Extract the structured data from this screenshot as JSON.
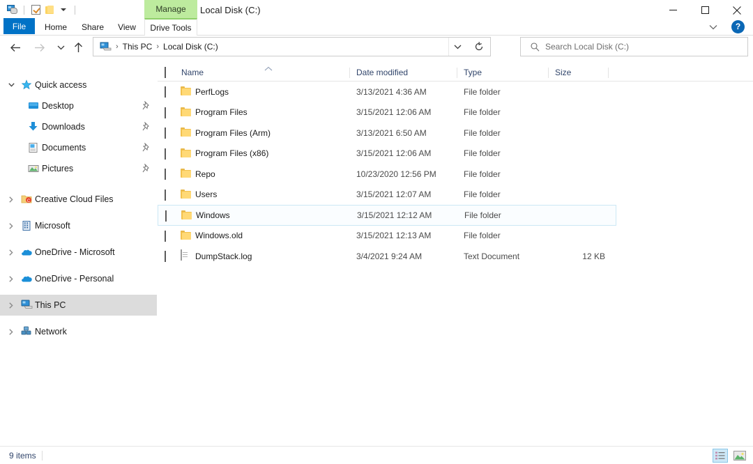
{
  "window": {
    "document_title": "Local Disk (C:)",
    "contextual_tab_group": "Manage",
    "controls": {
      "minimize": "Minimize",
      "maximize": "Maximize",
      "close": "Close"
    },
    "ribbon_collapse": "Minimize the Ribbon",
    "help": "?"
  },
  "quick_access_toolbar": {
    "items": [
      {
        "name": "explorer-icon",
        "label": "File Explorer"
      },
      {
        "name": "properties-icon",
        "label": "Properties"
      },
      {
        "name": "new-folder-icon",
        "label": "New folder"
      },
      {
        "name": "customize-caret-icon",
        "label": "Customize Quick Access Toolbar"
      }
    ]
  },
  "ribbon": {
    "tabs": [
      {
        "label": "File",
        "state": "file"
      },
      {
        "label": "Home",
        "state": "normal"
      },
      {
        "label": "Share",
        "state": "normal"
      },
      {
        "label": "View",
        "state": "normal"
      },
      {
        "label": "Drive Tools",
        "state": "active-contextual"
      }
    ]
  },
  "navigation": {
    "back": "Back",
    "forward": "Forward",
    "recent": "Recent locations",
    "up": "Up",
    "breadcrumb": {
      "root_icon": "this-pc-icon",
      "parts": [
        "This PC",
        "Local Disk (C:)"
      ],
      "separator": "›"
    },
    "address_dropdown": "Previous locations",
    "refresh": "Refresh “Local Disk (C:)”",
    "search": {
      "placeholder": "Search Local Disk (C:)",
      "value": "",
      "icon": "search-icon"
    }
  },
  "sidebar": {
    "items": [
      {
        "label": "Quick access",
        "icon": "star-icon",
        "level": 0,
        "expander": "chevron-down",
        "selected": false,
        "pinned": false
      },
      {
        "label": "Desktop",
        "icon": "desktop-icon",
        "level": 1,
        "expander": "none",
        "selected": false,
        "pinned": true
      },
      {
        "label": "Downloads",
        "icon": "downloads-icon",
        "level": 1,
        "expander": "none",
        "selected": false,
        "pinned": true
      },
      {
        "label": "Documents",
        "icon": "documents-icon",
        "level": 1,
        "expander": "none",
        "selected": false,
        "pinned": true
      },
      {
        "label": "Pictures",
        "icon": "pictures-icon",
        "level": 1,
        "expander": "none",
        "selected": false,
        "pinned": true
      },
      {
        "label": "Creative Cloud Files",
        "icon": "creative-cloud-icon",
        "level": 0,
        "expander": "chevron-right",
        "selected": false,
        "pinned": false
      },
      {
        "label": "Microsoft",
        "icon": "microsoft-building-icon",
        "level": 0,
        "expander": "chevron-right",
        "selected": false,
        "pinned": false
      },
      {
        "label": "OneDrive - Microsoft",
        "icon": "onedrive-cloud-icon",
        "level": 0,
        "expander": "chevron-right",
        "selected": false,
        "pinned": false
      },
      {
        "label": "OneDrive - Personal",
        "icon": "onedrive-cloud-icon",
        "level": 0,
        "expander": "chevron-right",
        "selected": false,
        "pinned": false
      },
      {
        "label": "This PC",
        "icon": "this-pc-icon",
        "level": 0,
        "expander": "chevron-right",
        "selected": true,
        "pinned": false
      },
      {
        "label": "Network",
        "icon": "network-icon",
        "level": 0,
        "expander": "chevron-right",
        "selected": false,
        "pinned": false
      }
    ]
  },
  "file_list": {
    "select_all_checkbox": false,
    "columns": [
      {
        "key": "name",
        "label": "Name",
        "sorted": "ascending"
      },
      {
        "key": "date",
        "label": "Date modified",
        "sorted": "none"
      },
      {
        "key": "type",
        "label": "Type",
        "sorted": "none"
      },
      {
        "key": "size",
        "label": "Size",
        "sorted": "none"
      }
    ],
    "rows": [
      {
        "name": "PerfLogs",
        "date": "3/13/2021 4:36 AM",
        "type": "File folder",
        "size": "",
        "icon": "folder-icon",
        "focused": false,
        "checked": false
      },
      {
        "name": "Program Files",
        "date": "3/15/2021 12:06 AM",
        "type": "File folder",
        "size": "",
        "icon": "folder-icon",
        "focused": false,
        "checked": false
      },
      {
        "name": "Program Files (Arm)",
        "date": "3/13/2021 6:50 AM",
        "type": "File folder",
        "size": "",
        "icon": "folder-icon",
        "focused": false,
        "checked": false
      },
      {
        "name": "Program Files (x86)",
        "date": "3/15/2021 12:06 AM",
        "type": "File folder",
        "size": "",
        "icon": "folder-icon",
        "focused": false,
        "checked": false
      },
      {
        "name": "Repo",
        "date": "10/23/2020 12:56 PM",
        "type": "File folder",
        "size": "",
        "icon": "folder-icon",
        "focused": false,
        "checked": false
      },
      {
        "name": "Users",
        "date": "3/15/2021 12:07 AM",
        "type": "File folder",
        "size": "",
        "icon": "folder-icon",
        "focused": false,
        "checked": false
      },
      {
        "name": "Windows",
        "date": "3/15/2021 12:12 AM",
        "type": "File folder",
        "size": "",
        "icon": "folder-icon",
        "focused": true,
        "checked": false
      },
      {
        "name": "Windows.old",
        "date": "3/15/2021 12:13 AM",
        "type": "File folder",
        "size": "",
        "icon": "folder-icon",
        "focused": false,
        "checked": false
      },
      {
        "name": "DumpStack.log",
        "date": "3/4/2021 9:24 AM",
        "type": "Text Document",
        "size": "12 KB",
        "icon": "text-document-icon",
        "focused": false,
        "checked": false
      }
    ]
  },
  "status_bar": {
    "item_count": "9 items",
    "views": [
      {
        "name": "details-view-button",
        "label": "Details view",
        "selected": true
      },
      {
        "name": "large-icons-view-button",
        "label": "Large icons view",
        "selected": false
      }
    ]
  },
  "colors": {
    "accent_blue": "#0072c6",
    "contextual_green": "#bdeb9e",
    "contextual_green_border": "#8fcf6a",
    "folder_yellow": "#f2c14e",
    "selection_gray": "#dcdcdc",
    "focus_border": "#cce8f5",
    "header_text": "#31456b"
  }
}
